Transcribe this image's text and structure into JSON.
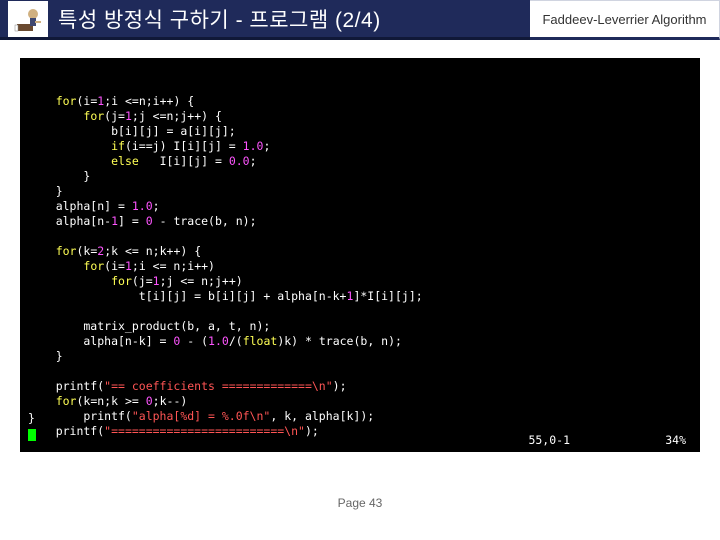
{
  "header": {
    "title": "특성 방정식 구하기 - 프로그램 (2/4)",
    "algorithm": "Faddeev-Leverrier Algorithm"
  },
  "code": {
    "lines": [
      {
        "tokens": [
          [
            "    ",
            ""
          ],
          [
            "for",
            "kw"
          ],
          [
            "(i=",
            ""
          ],
          [
            "1",
            "num"
          ],
          [
            ";i <=n;i++) {",
            ""
          ]
        ]
      },
      {
        "tokens": [
          [
            "        ",
            ""
          ],
          [
            "for",
            "kw"
          ],
          [
            "(j=",
            ""
          ],
          [
            "1",
            "num"
          ],
          [
            ";j <=n;j++) {",
            ""
          ]
        ]
      },
      {
        "tokens": [
          [
            "            b[i][j] = a[i][j];",
            ""
          ]
        ]
      },
      {
        "tokens": [
          [
            "            ",
            ""
          ],
          [
            "if",
            "kw"
          ],
          [
            "(i==j) I[i][j] = ",
            ""
          ],
          [
            "1.0",
            "num"
          ],
          [
            ";",
            ""
          ]
        ]
      },
      {
        "tokens": [
          [
            "            ",
            ""
          ],
          [
            "else",
            "kw"
          ],
          [
            "   I[i][j] = ",
            ""
          ],
          [
            "0.0",
            "num"
          ],
          [
            ";",
            ""
          ]
        ]
      },
      {
        "tokens": [
          [
            "        }",
            ""
          ]
        ]
      },
      {
        "tokens": [
          [
            "    }",
            ""
          ]
        ]
      },
      {
        "tokens": [
          [
            "    alpha[n] = ",
            ""
          ],
          [
            "1.0",
            "num"
          ],
          [
            ";",
            ""
          ]
        ]
      },
      {
        "tokens": [
          [
            "    alpha[n-",
            ""
          ],
          [
            "1",
            "num"
          ],
          [
            "] = ",
            ""
          ],
          [
            "0",
            "num"
          ],
          [
            " - trace(b, n);",
            ""
          ]
        ]
      },
      {
        "tokens": [
          [
            "",
            ""
          ]
        ]
      },
      {
        "tokens": [
          [
            "    ",
            ""
          ],
          [
            "for",
            "kw"
          ],
          [
            "(k=",
            ""
          ],
          [
            "2",
            "num"
          ],
          [
            ";k <= n;k++) {",
            ""
          ]
        ]
      },
      {
        "tokens": [
          [
            "        ",
            ""
          ],
          [
            "for",
            "kw"
          ],
          [
            "(i=",
            ""
          ],
          [
            "1",
            "num"
          ],
          [
            ";i <= n;i++)",
            ""
          ]
        ]
      },
      {
        "tokens": [
          [
            "            ",
            ""
          ],
          [
            "for",
            "kw"
          ],
          [
            "(j=",
            ""
          ],
          [
            "1",
            "num"
          ],
          [
            ";j <= n;j++)",
            ""
          ]
        ]
      },
      {
        "tokens": [
          [
            "                t[i][j] = b[i][j] + alpha[n-k+",
            ""
          ],
          [
            "1",
            "num"
          ],
          [
            "]*I[i][j];",
            ""
          ]
        ]
      },
      {
        "tokens": [
          [
            "",
            ""
          ]
        ]
      },
      {
        "tokens": [
          [
            "        matrix_product(b, a, t, n);",
            ""
          ]
        ]
      },
      {
        "tokens": [
          [
            "        alpha[n-k] = ",
            ""
          ],
          [
            "0",
            "num"
          ],
          [
            " - (",
            ""
          ],
          [
            "1.0",
            "num"
          ],
          [
            "/(",
            ""
          ],
          [
            "float",
            "kw"
          ],
          [
            ")k) * trace(b, n);",
            ""
          ]
        ]
      },
      {
        "tokens": [
          [
            "    }",
            ""
          ]
        ]
      },
      {
        "tokens": [
          [
            "",
            ""
          ]
        ]
      },
      {
        "tokens": [
          [
            "    printf(",
            ""
          ],
          [
            "\"== coefficients =============\\n\"",
            "str"
          ],
          [
            ");",
            ""
          ]
        ]
      },
      {
        "tokens": [
          [
            "    ",
            ""
          ],
          [
            "for",
            "kw"
          ],
          [
            "(k=n;k >= ",
            ""
          ],
          [
            "0",
            "num"
          ],
          [
            ";k--)",
            ""
          ]
        ]
      },
      {
        "tokens": [
          [
            "        printf(",
            ""
          ],
          [
            "\"alpha[%d] = %.0f\\n\"",
            "str"
          ],
          [
            ", k, alpha[k]);",
            ""
          ]
        ]
      },
      {
        "tokens": [
          [
            "    printf(",
            ""
          ],
          [
            "\"=========================\\n\"",
            "str"
          ],
          [
            ");",
            ""
          ]
        ]
      }
    ],
    "closing_brace": "}",
    "status_left": "55,0-1",
    "status_right": "34%"
  },
  "footer": {
    "page": "Page 43"
  }
}
